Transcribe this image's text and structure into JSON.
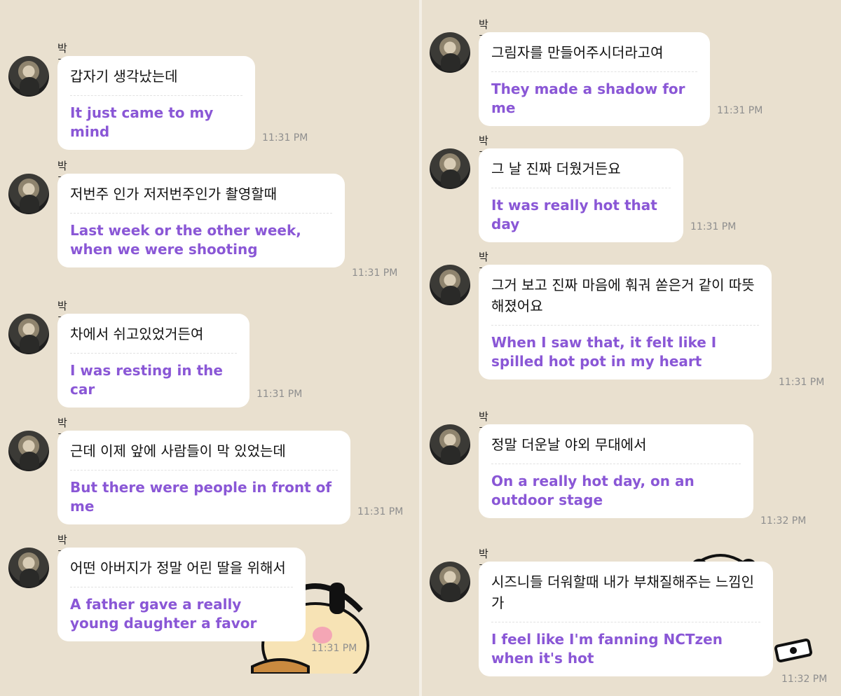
{
  "sender_name": "박지성",
  "left_messages": [
    {
      "korean": "갑자기 생각났는데",
      "english": "It just came to my mind",
      "time": "11:31 PM"
    },
    {
      "korean": "저번주 인가 저저번주인가 촬영할때",
      "english": "Last week or the other week, when we were shooting",
      "time": "11:31 PM"
    },
    {
      "korean": "차에서 쉬고있었거든여",
      "english": "I was resting in the car",
      "time": "11:31 PM"
    },
    {
      "korean": "근데 이제 앞에 사람들이 막 있었는데",
      "english": "But there were people in front of me",
      "time": "11:31 PM"
    },
    {
      "korean": "어떤 아버지가 정말 어린 딸을 위해서",
      "english": "A father gave a really young daughter a favor",
      "time": "11:31 PM"
    }
  ],
  "right_messages": [
    {
      "korean": "그림자를 만들어주시더라고여",
      "english": "They made a shadow for me",
      "time": "11:31 PM"
    },
    {
      "korean": "그 날 진짜 더웠거든요",
      "english": "It was really hot that day",
      "time": "11:31 PM"
    },
    {
      "korean": "그거 보고 진짜 마음에 훠궈 쏟은거 같이 따뜻해졌어요",
      "english": "When I saw that, it felt like I spilled hot pot in my heart",
      "time": "11:31 PM"
    },
    {
      "korean": "정말 더운날 야외 무대에서",
      "english": "On a really hot day, on an outdoor stage",
      "time": "11:32 PM"
    },
    {
      "korean": "시즈니들 더워할때 내가 부채질해주는 느낌인가",
      "english": "I feel like I'm fanning NCTzen when it's hot",
      "time": "11:32 PM"
    }
  ],
  "icons": {
    "avatar": "profile-photo",
    "sticker_left": "bear-headphones-sticker",
    "sticker_right": "bear-fan-sticker"
  }
}
